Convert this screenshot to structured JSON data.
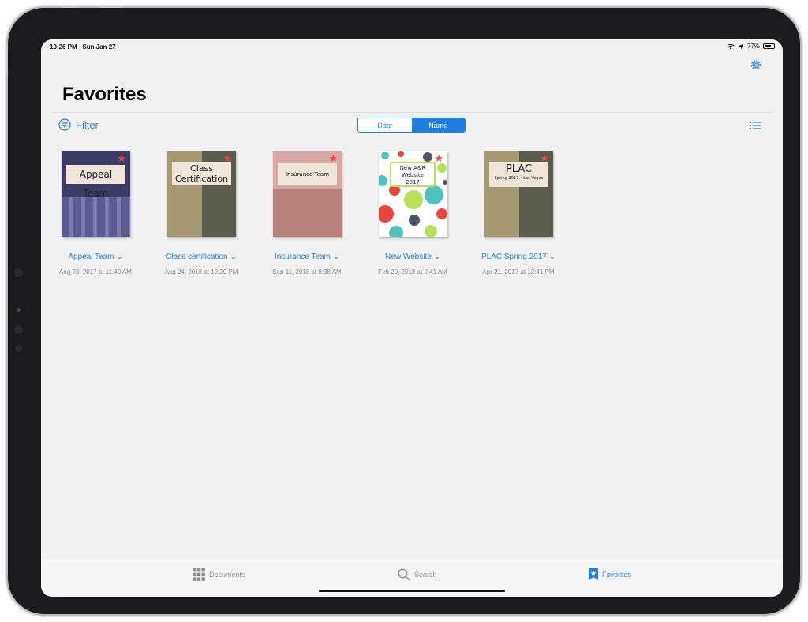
{
  "status_bar": {
    "time": "10:26 PM",
    "date": "Sun Jan 27",
    "battery": "77%",
    "battery_level": 0.77
  },
  "page": {
    "title": "Favorites"
  },
  "toolbar": {
    "filter_label": "Filter",
    "sort_options": [
      "Date",
      "Name"
    ],
    "selected_sort": "Name"
  },
  "documents": [
    {
      "name": "Appeal Team",
      "date": "Aug 23, 2017 at 11:40 AM",
      "cover_text": "Appeal Team"
    },
    {
      "name": "Class certification",
      "date": "Aug 24, 2018 at 12:20 PM",
      "cover_text": "Class Certification"
    },
    {
      "name": "Insurance Team",
      "date": "Sep 11, 2018 at 8:38 AM",
      "cover_text": "Insurance Team"
    },
    {
      "name": "New Website",
      "date": "Feb 20, 2018 at 9:41 AM",
      "cover_text_lines": [
        "New A&R",
        "Website",
        "2017"
      ]
    },
    {
      "name": "PLAC Spring 2017",
      "date": "Apr 21, 2017 at 12:41 PM",
      "cover_title": "PLAC",
      "cover_subtitle": "Spring 2017 • Las Vegas"
    }
  ],
  "tabbar": {
    "documents_label": "Documents",
    "search_label": "Search",
    "favorites_label": "Favorites"
  },
  "colors": {
    "accent": "#1f7fe0",
    "favorite_star": "#e8453c"
  }
}
